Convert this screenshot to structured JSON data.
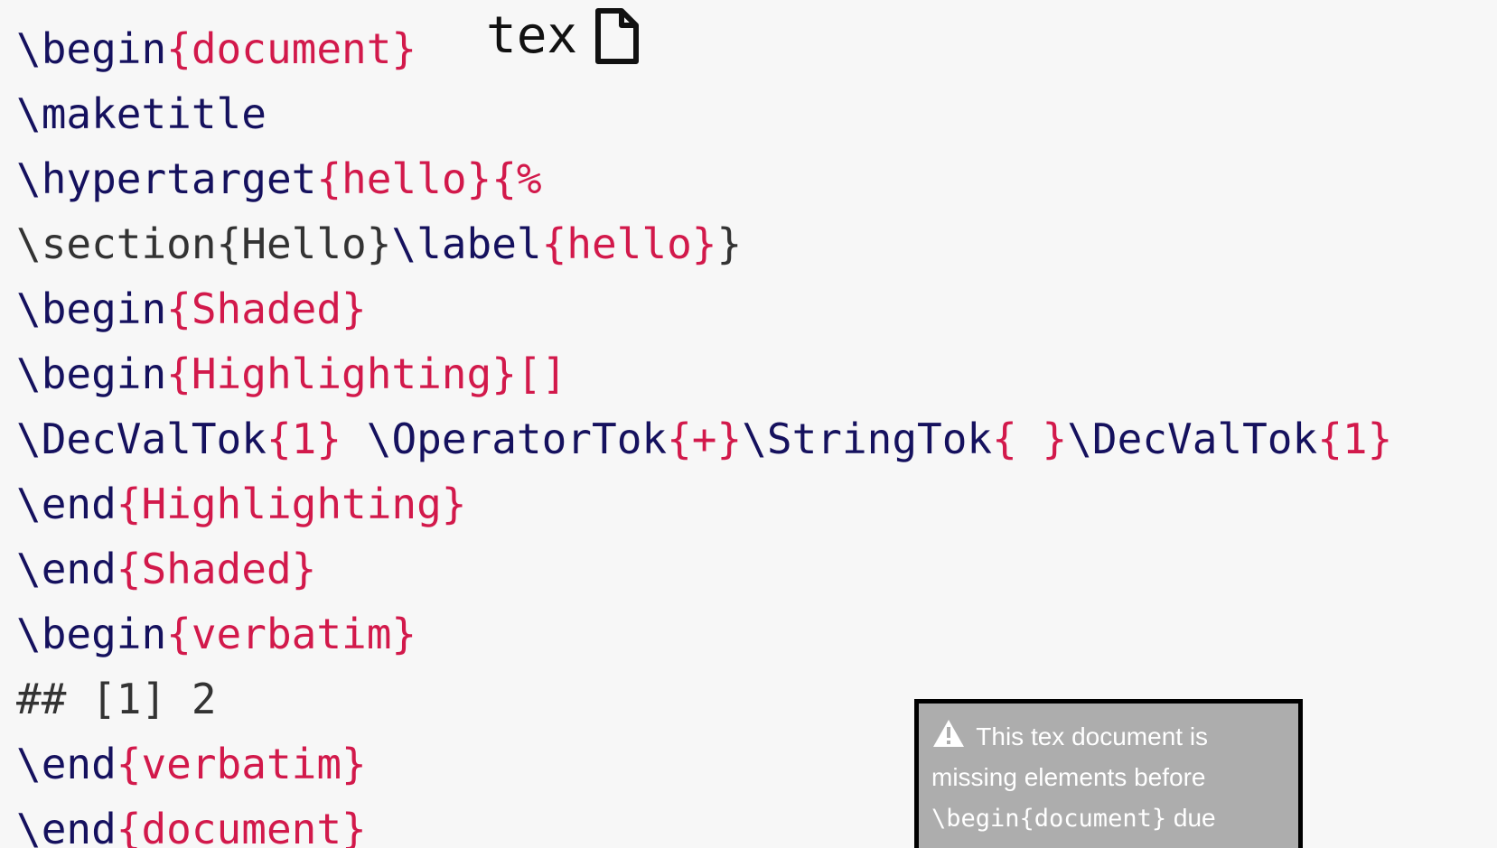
{
  "file_header": {
    "extension": "tex",
    "icon": "file-icon"
  },
  "code_lines": [
    [
      {
        "cls": "tok-cmd",
        "text": "\\begin"
      },
      {
        "cls": "tok-arg",
        "text": "{document}"
      }
    ],
    [
      {
        "cls": "tok-cmd",
        "text": "\\maketitle"
      }
    ],
    [
      {
        "cls": "tok-cmd",
        "text": "\\hypertarget"
      },
      {
        "cls": "tok-arg",
        "text": "{hello}{%"
      }
    ],
    [
      {
        "cls": "tok-plain",
        "text": "\\section{Hello}"
      },
      {
        "cls": "tok-cmd",
        "text": "\\label"
      },
      {
        "cls": "tok-arg",
        "text": "{hello}"
      },
      {
        "cls": "tok-plain",
        "text": "}"
      }
    ],
    [
      {
        "cls": "tok-cmd",
        "text": "\\begin"
      },
      {
        "cls": "tok-arg",
        "text": "{Shaded}"
      }
    ],
    [
      {
        "cls": "tok-cmd",
        "text": "\\begin"
      },
      {
        "cls": "tok-arg",
        "text": "{Highlighting}[]"
      }
    ],
    [
      {
        "cls": "tok-cmd",
        "text": "\\DecValTok"
      },
      {
        "cls": "tok-arg",
        "text": "{1}"
      },
      {
        "cls": "tok-plain",
        "text": " "
      },
      {
        "cls": "tok-cmd",
        "text": "\\OperatorTok"
      },
      {
        "cls": "tok-arg",
        "text": "{+}"
      },
      {
        "cls": "tok-cmd",
        "text": "\\StringTok"
      },
      {
        "cls": "tok-arg",
        "text": "{ }"
      },
      {
        "cls": "tok-cmd",
        "text": "\\DecValTok"
      },
      {
        "cls": "tok-arg",
        "text": "{1}"
      }
    ],
    [
      {
        "cls": "tok-cmd",
        "text": "\\end"
      },
      {
        "cls": "tok-arg",
        "text": "{Highlighting}"
      }
    ],
    [
      {
        "cls": "tok-cmd",
        "text": "\\end"
      },
      {
        "cls": "tok-arg",
        "text": "{Shaded}"
      }
    ],
    [
      {
        "cls": "tok-cmd",
        "text": "\\begin"
      },
      {
        "cls": "tok-arg",
        "text": "{verbatim}"
      }
    ],
    [
      {
        "cls": "tok-plain",
        "text": "## [1] 2"
      }
    ],
    [
      {
        "cls": "tok-cmd",
        "text": "\\end"
      },
      {
        "cls": "tok-arg",
        "text": "{verbatim}"
      }
    ],
    [
      {
        "cls": "tok-cmd",
        "text": "\\end"
      },
      {
        "cls": "tok-arg",
        "text": "{document}"
      }
    ]
  ],
  "warning": {
    "icon": "warning-icon",
    "text_before": "This tex document is missing elements before",
    "code": "\\begin{document}",
    "text_after": "due"
  },
  "colors": {
    "background": "#f7f7f7",
    "command": "#15115e",
    "argument": "#d2194b",
    "plain": "#333333",
    "warning_background": "#adadad",
    "warning_border": "#000000"
  }
}
